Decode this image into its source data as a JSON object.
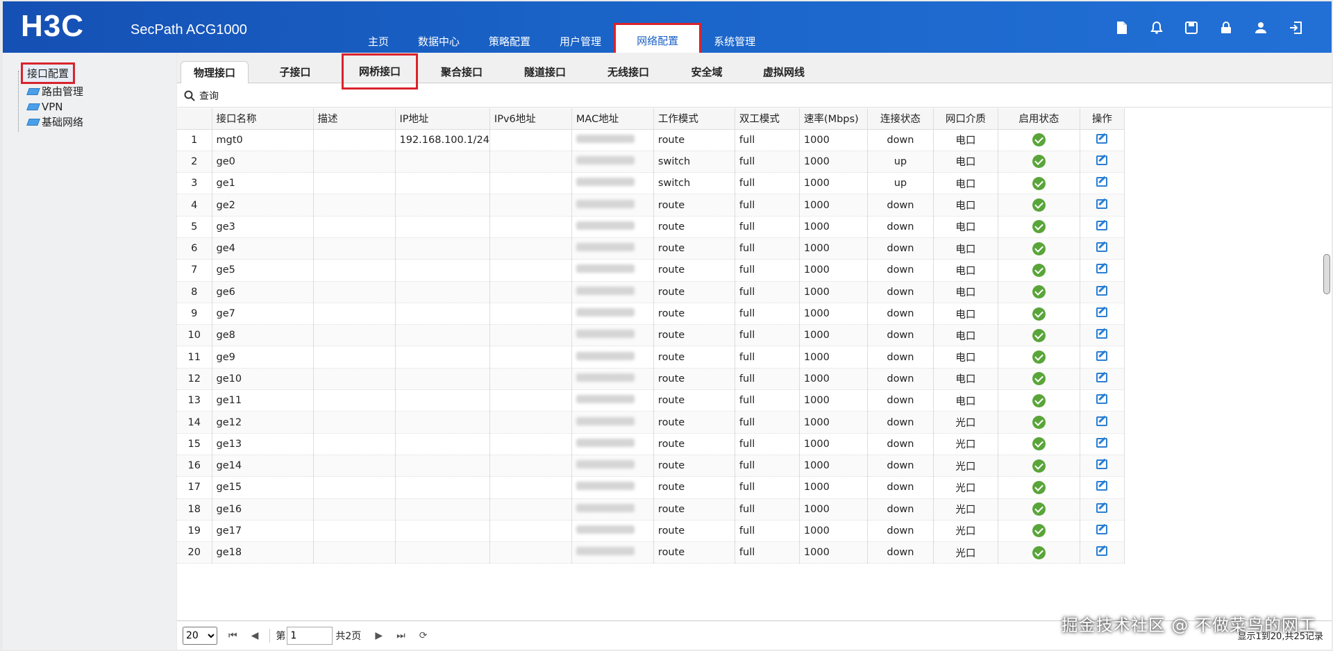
{
  "header": {
    "logo": "H3C",
    "product": "SecPath ACG1000",
    "nav": [
      "主页",
      "数据中心",
      "策略配置",
      "用户管理",
      "网络配置",
      "系统管理"
    ],
    "active_nav": 4,
    "icons": [
      "document-icon",
      "bell-icon",
      "save-icon",
      "lock-icon",
      "user-icon",
      "logout-icon"
    ]
  },
  "sidebar": {
    "root": "接口配置",
    "children": [
      "路由管理",
      "VPN",
      "基础网络"
    ]
  },
  "tabs": [
    "物理接口",
    "子接口",
    "网桥接口",
    "聚合接口",
    "隧道接口",
    "无线接口",
    "安全域",
    "虚拟网线"
  ],
  "search_label": "查询",
  "table": {
    "headers": [
      "",
      "接口名称",
      "描述",
      "IP地址",
      "IPv6地址",
      "MAC地址",
      "工作模式",
      "双工模式",
      "速率(Mbps)",
      "连接状态",
      "网口介质",
      "启用状态",
      "操作"
    ],
    "rows": [
      {
        "no": "1",
        "name": "mgt0",
        "desc": "",
        "ip": "192.168.100.1/24",
        "ipv6": "",
        "mode": "route",
        "duplex": "full",
        "speed": "1000",
        "link": "down",
        "medium": "电口"
      },
      {
        "no": "2",
        "name": "ge0",
        "desc": "",
        "ip": "",
        "ipv6": "",
        "mode": "switch",
        "duplex": "full",
        "speed": "1000",
        "link": "up",
        "medium": "电口"
      },
      {
        "no": "3",
        "name": "ge1",
        "desc": "",
        "ip": "",
        "ipv6": "",
        "mode": "switch",
        "duplex": "full",
        "speed": "1000",
        "link": "up",
        "medium": "电口"
      },
      {
        "no": "4",
        "name": "ge2",
        "desc": "",
        "ip": "",
        "ipv6": "",
        "mode": "route",
        "duplex": "full",
        "speed": "1000",
        "link": "down",
        "medium": "电口"
      },
      {
        "no": "5",
        "name": "ge3",
        "desc": "",
        "ip": "",
        "ipv6": "",
        "mode": "route",
        "duplex": "full",
        "speed": "1000",
        "link": "down",
        "medium": "电口"
      },
      {
        "no": "6",
        "name": "ge4",
        "desc": "",
        "ip": "",
        "ipv6": "",
        "mode": "route",
        "duplex": "full",
        "speed": "1000",
        "link": "down",
        "medium": "电口"
      },
      {
        "no": "7",
        "name": "ge5",
        "desc": "",
        "ip": "",
        "ipv6": "",
        "mode": "route",
        "duplex": "full",
        "speed": "1000",
        "link": "down",
        "medium": "电口"
      },
      {
        "no": "8",
        "name": "ge6",
        "desc": "",
        "ip": "",
        "ipv6": "",
        "mode": "route",
        "duplex": "full",
        "speed": "1000",
        "link": "down",
        "medium": "电口"
      },
      {
        "no": "9",
        "name": "ge7",
        "desc": "",
        "ip": "",
        "ipv6": "",
        "mode": "route",
        "duplex": "full",
        "speed": "1000",
        "link": "down",
        "medium": "电口"
      },
      {
        "no": "10",
        "name": "ge8",
        "desc": "",
        "ip": "",
        "ipv6": "",
        "mode": "route",
        "duplex": "full",
        "speed": "1000",
        "link": "down",
        "medium": "电口"
      },
      {
        "no": "11",
        "name": "ge9",
        "desc": "",
        "ip": "",
        "ipv6": "",
        "mode": "route",
        "duplex": "full",
        "speed": "1000",
        "link": "down",
        "medium": "电口"
      },
      {
        "no": "12",
        "name": "ge10",
        "desc": "",
        "ip": "",
        "ipv6": "",
        "mode": "route",
        "duplex": "full",
        "speed": "1000",
        "link": "down",
        "medium": "电口"
      },
      {
        "no": "13",
        "name": "ge11",
        "desc": "",
        "ip": "",
        "ipv6": "",
        "mode": "route",
        "duplex": "full",
        "speed": "1000",
        "link": "down",
        "medium": "电口"
      },
      {
        "no": "14",
        "name": "ge12",
        "desc": "",
        "ip": "",
        "ipv6": "",
        "mode": "route",
        "duplex": "full",
        "speed": "1000",
        "link": "down",
        "medium": "光口"
      },
      {
        "no": "15",
        "name": "ge13",
        "desc": "",
        "ip": "",
        "ipv6": "",
        "mode": "route",
        "duplex": "full",
        "speed": "1000",
        "link": "down",
        "medium": "光口"
      },
      {
        "no": "16",
        "name": "ge14",
        "desc": "",
        "ip": "",
        "ipv6": "",
        "mode": "route",
        "duplex": "full",
        "speed": "1000",
        "link": "down",
        "medium": "光口"
      },
      {
        "no": "17",
        "name": "ge15",
        "desc": "",
        "ip": "",
        "ipv6": "",
        "mode": "route",
        "duplex": "full",
        "speed": "1000",
        "link": "down",
        "medium": "光口"
      },
      {
        "no": "18",
        "name": "ge16",
        "desc": "",
        "ip": "",
        "ipv6": "",
        "mode": "route",
        "duplex": "full",
        "speed": "1000",
        "link": "down",
        "medium": "光口"
      },
      {
        "no": "19",
        "name": "ge17",
        "desc": "",
        "ip": "",
        "ipv6": "",
        "mode": "route",
        "duplex": "full",
        "speed": "1000",
        "link": "down",
        "medium": "光口"
      },
      {
        "no": "20",
        "name": "ge18",
        "desc": "",
        "ip": "",
        "ipv6": "",
        "mode": "route",
        "duplex": "full",
        "speed": "1000",
        "link": "down",
        "medium": "光口"
      }
    ]
  },
  "pager": {
    "page_size": "20",
    "page_prefix": "第",
    "page_value": "1",
    "page_total": "共2页",
    "summary": "显示1到20,共25记录"
  },
  "watermark": "掘金技术社区 @ 不做菜鸟的网工"
}
